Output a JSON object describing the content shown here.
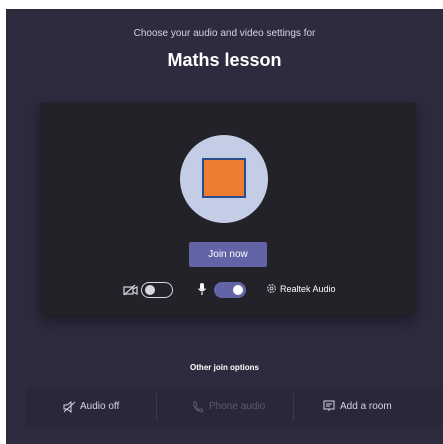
{
  "prejoin": {
    "subtitle": "Choose your audio and video settings for",
    "meeting_title": "Maths lesson"
  },
  "preview": {
    "avatar_icon": "avatar-image-icon",
    "join_button_label": "Join now"
  },
  "controls": {
    "camera_icon": "camera-off-icon",
    "camera_enabled": false,
    "mic_icon": "microphone-icon",
    "mic_enabled": true,
    "audio_device_icon": "gear-icon",
    "audio_device_label": "Realtek Audio"
  },
  "other_options": {
    "heading": "Other join options",
    "items": [
      {
        "icon": "speaker-off-icon",
        "label": "Audio off",
        "enabled": true
      },
      {
        "icon": "phone-icon",
        "label": "Phone audio",
        "enabled": false
      },
      {
        "icon": "cast-icon",
        "label": "Add a room",
        "enabled": true
      }
    ]
  },
  "colors": {
    "background": "#2d2c3f",
    "card": "#222228",
    "accent": "#6264a7",
    "avatar_circle": "#c3cde5",
    "avatar_image": "#ed7d31",
    "options_bar": "#292838",
    "disabled_text": "#5c5b6e"
  }
}
